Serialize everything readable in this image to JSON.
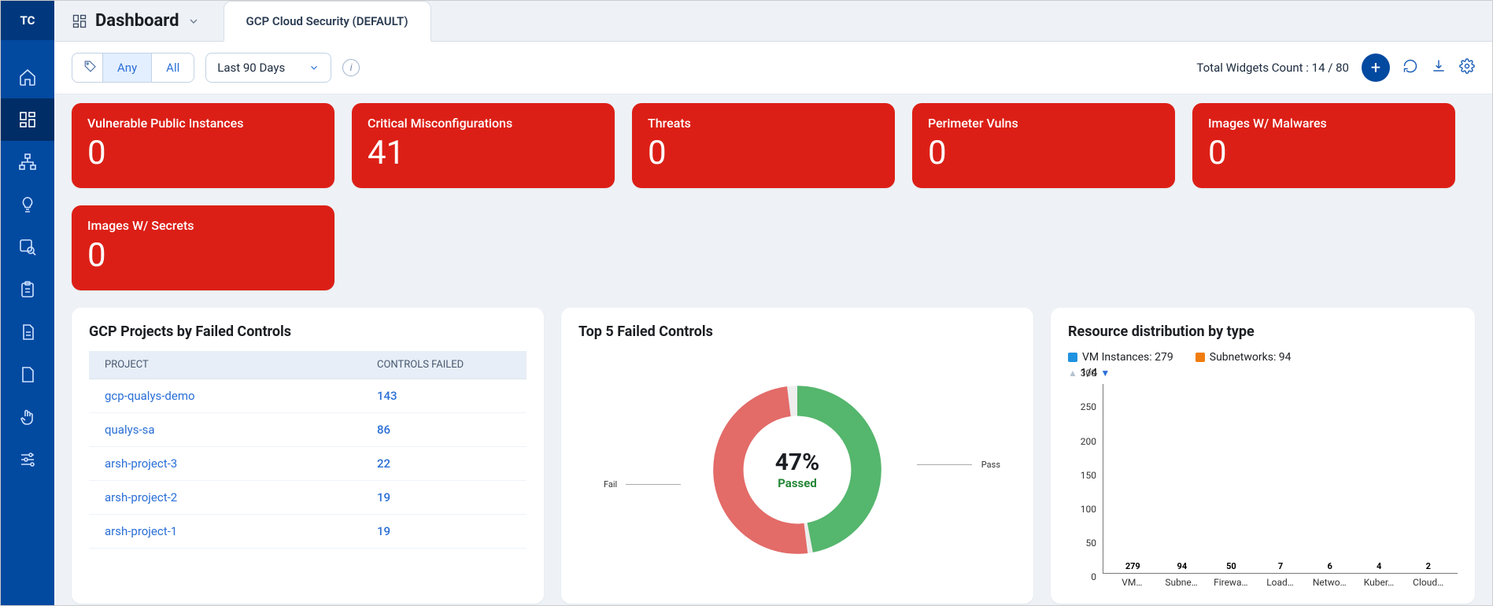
{
  "brand": {
    "logo_text": "TC"
  },
  "header": {
    "title": "Dashboard",
    "tab": "GCP Cloud Security (DEFAULT)"
  },
  "toolbar": {
    "filter_any": "Any",
    "filter_all": "All",
    "time_range": "Last 90 Days",
    "widgets_count_label": "Total Widgets Count : 14 / 80"
  },
  "kpis": [
    {
      "label": "Vulnerable Public Instances",
      "value": "0"
    },
    {
      "label": "Critical Misconfigurations",
      "value": "41"
    },
    {
      "label": "Threats",
      "value": "0"
    },
    {
      "label": "Perimeter Vulns",
      "value": "0"
    },
    {
      "label": "Images W/ Malwares",
      "value": "0"
    },
    {
      "label": "Images W/ Secrets",
      "value": "0"
    }
  ],
  "projects_card": {
    "title": "GCP Projects by Failed Controls",
    "col_project": "PROJECT",
    "col_controls": "CONTROLS FAILED",
    "rows": [
      {
        "project": "gcp-qualys-demo",
        "controls": "143"
      },
      {
        "project": "qualys-sa",
        "controls": "86"
      },
      {
        "project": "arsh-project-3",
        "controls": "22"
      },
      {
        "project": "arsh-project-2",
        "controls": "19"
      },
      {
        "project": "arsh-project-1",
        "controls": "19"
      }
    ]
  },
  "donut_card": {
    "title": "Top 5 Failed Controls",
    "center_pct": "47%",
    "center_sub": "Passed",
    "label_pass": "Pass",
    "label_fail": "Fail"
  },
  "bar_card": {
    "title": "Resource distribution by type",
    "legend_a_label": "VM Instances: 279",
    "legend_b_label": "Subnetworks: 94",
    "page_label": "1/4",
    "colors": {
      "vm": "#1f93e0",
      "subnet": "#f07d0f",
      "firewall": "#b980e8",
      "load": "#24bfe0",
      "network": "#24bfe0",
      "kube": "#24bfe0",
      "cloud": "#e57bb1"
    }
  },
  "chart_data": [
    {
      "type": "donut",
      "title": "Top 5 Failed Controls",
      "series": [
        {
          "name": "Pass",
          "value": 47,
          "color": "#55b66d"
        },
        {
          "name": "Fail",
          "value": 53,
          "color": "#e36b68"
        }
      ],
      "center_label": "47% Passed"
    },
    {
      "type": "bar",
      "title": "Resource distribution by type",
      "ylabel": "",
      "xlabel": "",
      "ylim": [
        0,
        300
      ],
      "yticks": [
        0,
        50,
        100,
        150,
        200,
        250,
        300
      ],
      "categories": [
        "VM…",
        "Subne…",
        "Firewa…",
        "Load…",
        "Netwo…",
        "Kuber…",
        "Cloud…"
      ],
      "values": [
        279,
        94,
        50,
        7,
        6,
        4,
        2
      ],
      "colors": [
        "#1f93e0",
        "#f07d0f",
        "#b980e8",
        "#24bfe0",
        "#24bfe0",
        "#24bfe0",
        "#e57bb1"
      ],
      "legend": [
        "VM Instances: 279",
        "Subnetworks: 94"
      ],
      "page": "1/4"
    }
  ]
}
